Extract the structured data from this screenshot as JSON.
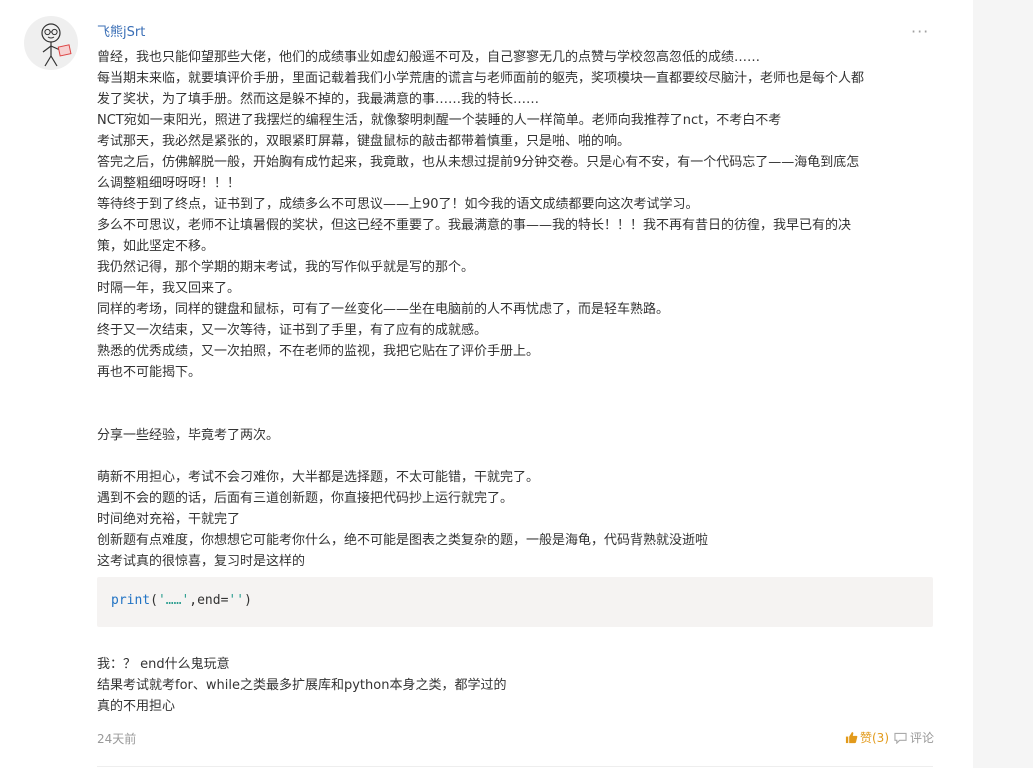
{
  "post": {
    "author": "飞熊jSrt",
    "more": "···",
    "paragraphs": [
      "曾经，我也只能仰望那些大佬，他们的成绩事业如虚幻般遥不可及，自己寥寥无几的点赞与学校忽高忽低的成绩……",
      "每当期末来临，就要填评价手册，里面记载着我们小学荒唐的谎言与老师面前的躯壳，奖项模块一直都要绞尽脑汁，老师也是每个人都",
      "发了奖状，为了填手册。然而这是躲不掉的，我最满意的事……我的特长……",
      "NCT宛如一束阳光，照进了我摆烂的编程生活，就像黎明刺醒一个装睡的人一样简单。老师向我推荐了nct，不考白不考",
      "考试那天，我必然是紧张的，双眼紧盯屏幕，键盘鼠标的敲击都带着慎重，只是啪、啪的响。",
      "答完之后，仿佛解脱一般，开始胸有成竹起来，我竟敢，也从未想过提前9分钟交卷。只是心有不安，有一个代码忘了——海龟到底怎",
      "么调整粗细呀呀呀！！！",
      "等待终于到了终点，证书到了，成绩多么不可思议——上90了！如今我的语文成绩都要向这次考试学习。",
      "多么不可思议，老师不让填暑假的奖状，但这已经不重要了。我最满意的事——我的特长！！！我不再有昔日的彷徨，我早已有的决",
      "策，如此坚定不移。",
      "我仍然记得，那个学期的期末考试，我的写作似乎就是写的那个。",
      "时隔一年，我又回来了。",
      "同样的考场，同样的键盘和鼠标，可有了一丝变化——坐在电脑前的人不再忧虑了，而是轻车熟路。",
      "终于又一次结束，又一次等待，证书到了手里，有了应有的成就感。",
      "熟悉的优秀成绩，又一次拍照，不在老师的监视，我把它贴在了评价手册上。",
      "再也不可能揭下。",
      "",
      "",
      "分享一些经验，毕竟考了两次。",
      "",
      "萌新不用担心，考试不会刁难你，大半都是选择题，不太可能错，干就完了。",
      "遇到不会的题的话，后面有三道创新题，你直接把代码抄上运行就完了。",
      "时间绝对充裕，干就完了",
      "创新题有点难度，你想想它可能考你什么，绝不可能是图表之类复杂的题，一般是海龟，代码背熟就没逝啦",
      "这考试真的很惊喜，复习时是这样的"
    ],
    "code": {
      "fn": "print",
      "open": "(",
      "str1": "'……'",
      "mid": ",end=",
      "str2": "''",
      "close": ")"
    },
    "after_code": [
      "我：？ end什么鬼玩意",
      "结果考试就考for、while之类最多扩展库和python本身之类，都学过的",
      "真的不用担心"
    ],
    "time": "24天前",
    "like_label": "赞(3)",
    "comment_label": "评论"
  },
  "colors": {
    "author": "#3b6fb6",
    "like": "#e29a1b",
    "muted": "#999999",
    "code_bg": "#f5f3f2"
  }
}
